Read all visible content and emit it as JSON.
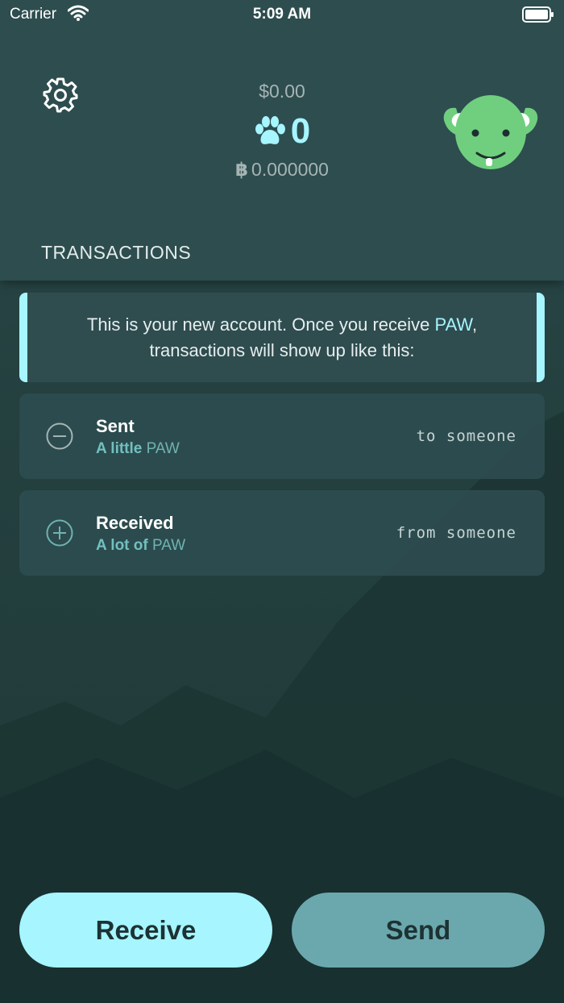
{
  "status_bar": {
    "carrier": "Carrier",
    "time": "5:09 AM"
  },
  "balance": {
    "fiat": "$0.00",
    "paw": "0",
    "btc_symbol": "฿",
    "btc": "0.000000"
  },
  "section_title": "TRANSACTIONS",
  "info_card": {
    "line1_prefix": "This is your new account. Once you receive ",
    "line1_accent": "PAW",
    "line1_suffix": ",",
    "line2": "transactions will show up like this:"
  },
  "transactions": [
    {
      "type": "Sent",
      "qty": "A little",
      "unit": "PAW",
      "party": "to someone",
      "icon": "minus-circle-icon"
    },
    {
      "type": "Received",
      "qty": "A lot of",
      "unit": "PAW",
      "party": "from someone",
      "icon": "plus-circle-icon"
    }
  ],
  "buttons": {
    "receive": "Receive",
    "send": "Send"
  },
  "colors": {
    "accent": "#a6f5ff",
    "header_bg": "#2e4d4f",
    "send_button": "#6ba8ae",
    "avatar_green": "#6fcf7f"
  }
}
